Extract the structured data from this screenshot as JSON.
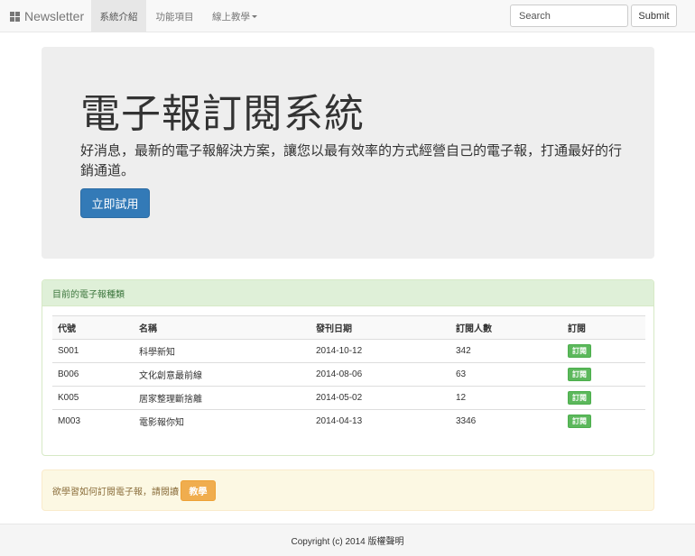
{
  "navbar": {
    "brand": "Newsletter",
    "items": [
      {
        "label": "系統介紹",
        "active": true
      },
      {
        "label": "功能項目",
        "active": false
      },
      {
        "label": "線上教學",
        "active": false
      }
    ],
    "search_placeholder": "Search",
    "submit_label": "Submit"
  },
  "jumbotron": {
    "title": "電子報訂閱系統",
    "text": "好消息，最新的電子報解決方案，讓您以最有效率的方式經營自己的電子報，打通最好的行銷通道。",
    "button": "立即試用"
  },
  "panel": {
    "heading": "目前的電子報種類",
    "columns": [
      "代號",
      "名稱",
      "發刊日期",
      "訂閱人數",
      "訂閱"
    ],
    "rows": [
      {
        "code": "S001",
        "name": "科學新知",
        "date": "2014-10-12",
        "subscribers": "342",
        "action": "訂閱"
      },
      {
        "code": "B006",
        "name": "文化創意最前線",
        "date": "2014-08-06",
        "subscribers": "63",
        "action": "訂閱"
      },
      {
        "code": "K005",
        "name": "居家整理斷捨離",
        "date": "2014-05-02",
        "subscribers": "12",
        "action": "訂閱"
      },
      {
        "code": "M003",
        "name": "電影報你知",
        "date": "2014-04-13",
        "subscribers": "3346",
        "action": "訂閱"
      }
    ]
  },
  "alert": {
    "text": "欲學習如何訂閱電子報，請閱讀",
    "button": "教學"
  },
  "footer": {
    "text": "Copyright (c) 2014 版權聲明"
  },
  "colors": {
    "primary": "#337ab7",
    "success": "#5cb85c",
    "warning": "#f0ad4e",
    "panel_heading_bg": "#dff0d8",
    "alert_bg": "#fcf8e3"
  }
}
